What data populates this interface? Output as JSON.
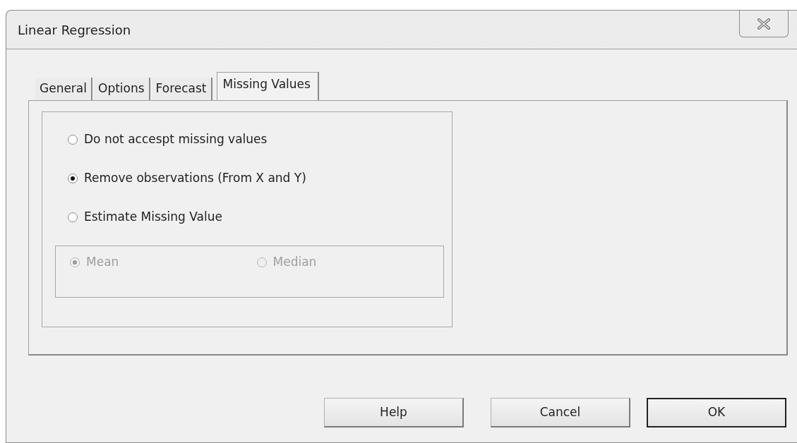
{
  "window": {
    "title": "Linear Regression"
  },
  "tabs": [
    {
      "label": "General",
      "selected": false
    },
    {
      "label": "Options",
      "selected": false
    },
    {
      "label": "Forecast",
      "selected": false
    },
    {
      "label": "Missing Values",
      "selected": true
    }
  ],
  "options": [
    {
      "label": "Do not accespt missing values",
      "selected": false,
      "disabled": false
    },
    {
      "label": "Remove observations (From X and Y)",
      "selected": true,
      "disabled": false
    },
    {
      "label": "Estimate Missing Value",
      "selected": false,
      "disabled": false
    }
  ],
  "estimate_options": [
    {
      "label": "Mean",
      "selected": true,
      "disabled": true
    },
    {
      "label": "Median",
      "selected": false,
      "disabled": true
    }
  ],
  "buttons": [
    {
      "label": "Help",
      "default": false
    },
    {
      "label": "Cancel",
      "default": false
    },
    {
      "label": "OK",
      "default": true
    }
  ]
}
